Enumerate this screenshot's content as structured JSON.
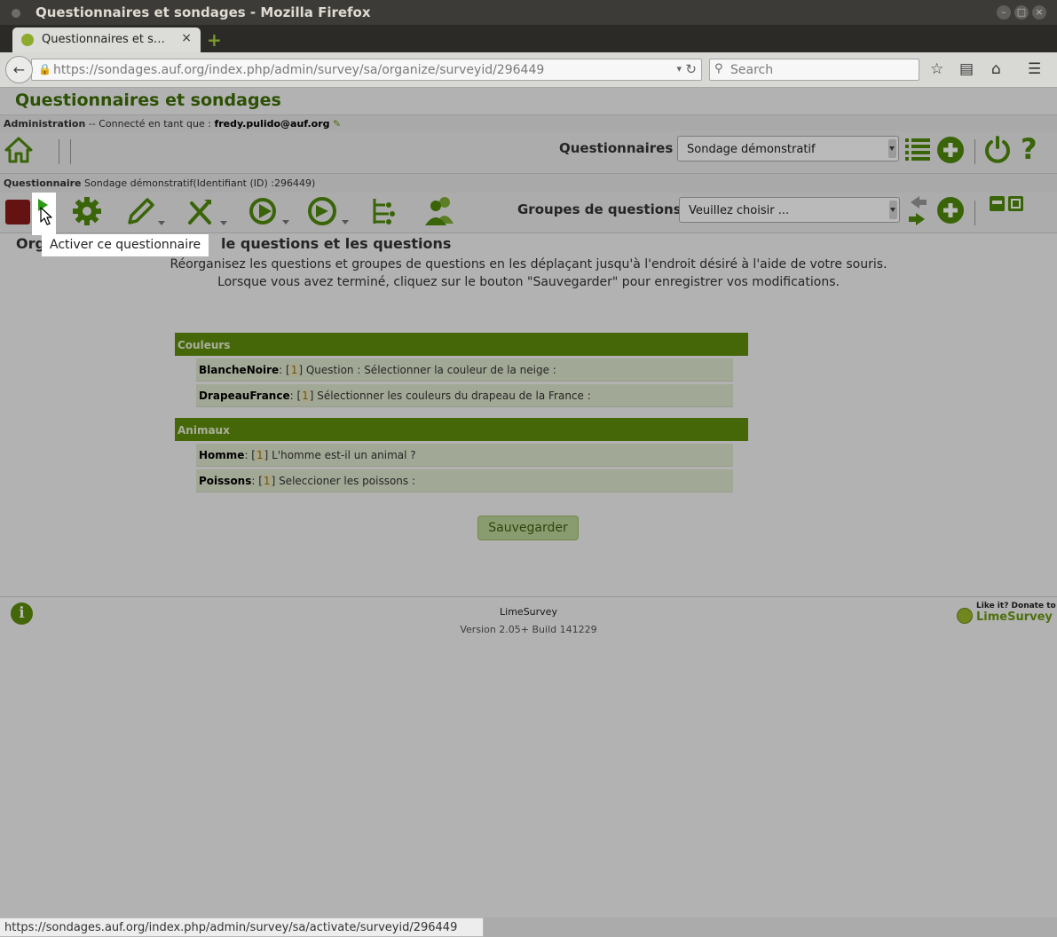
{
  "window": {
    "title": "Questionnaires et sondages - Mozilla Firefox"
  },
  "tab": {
    "label": "Questionnaires et s…",
    "close": "×",
    "new_tab": "+"
  },
  "nav": {
    "url": "https://sondages.auf.org/index.php/admin/survey/sa/organize/surveyid/296449",
    "search_placeholder": "Search"
  },
  "app": {
    "title": "Questionnaires et sondages",
    "admin_label": "Administration",
    "connected_text": " -- Connecté en tant que : ",
    "user": "fredy.pulido@auf.org",
    "questionnaires_label": "Questionnaires :",
    "survey_select": "Sondage démonstratif",
    "survey_label": "Questionnaire",
    "survey_info": " Sondage démonstratif(Identifiant (ID) :296449)",
    "groups_label": "Groupes de questions :",
    "groups_select": "Veuillez choisir ..."
  },
  "tooltip": {
    "text": "Activer ce questionnaire"
  },
  "content": {
    "heading_start": "Org",
    "heading_end": "le questions et les questions",
    "instruction_1": "Réorganisez les questions et groupes de questions en les déplaçant jusqu'à l'endroit désiré à l'aide de votre souris.",
    "instruction_2": "Lorsque vous avez terminé, cliquez sur le bouton \"Sauvegarder\" pour enregistrer vos modifications.",
    "groups": [
      {
        "name": "Couleurs",
        "questions": [
          {
            "code": "BlancheNoire",
            "sep": ": [",
            "num": "1",
            "close": "]",
            "text": " Question : Sélectionner la couleur de la neige :"
          },
          {
            "code": "DrapeauFrance",
            "sep": ": [",
            "num": "1",
            "close": "]",
            "text": " Sélectionner les couleurs du drapeau de la France :"
          }
        ]
      },
      {
        "name": "Animaux",
        "questions": [
          {
            "code": "Homme",
            "sep": ": [",
            "num": "1",
            "close": "]",
            "text": " L'homme est-il un animal ?"
          },
          {
            "code": "Poissons",
            "sep": ": [",
            "num": "1",
            "close": "]",
            "text": " Seleccioner les poissons :"
          }
        ]
      }
    ],
    "save_label": "Sauvegarder"
  },
  "footer": {
    "brand": "LimeSurvey",
    "version": "Version 2.05+ Build 141229",
    "donate_line1": "Like it? Donate to",
    "donate_line2": "LimeSurvey"
  },
  "status": {
    "url": "https://sondages.auf.org/index.php/admin/survey/sa/activate/surveyid/296449"
  },
  "colors": {
    "brand_green": "#618e0b",
    "title_green": "#3d6e06",
    "stop_red": "#8b1a1a"
  }
}
